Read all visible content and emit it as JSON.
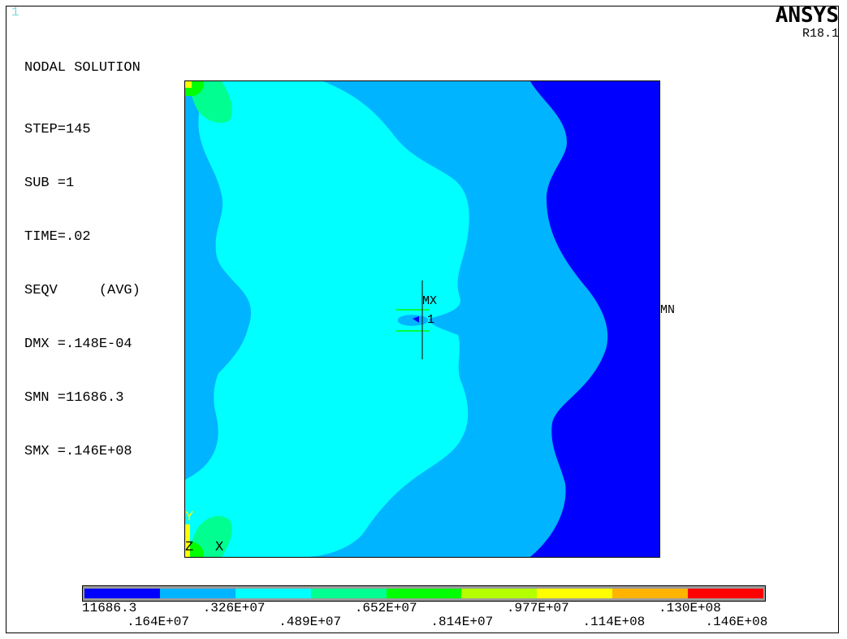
{
  "window": {
    "number": "1"
  },
  "logo": {
    "brand": "ANSYS",
    "release": "R18.1"
  },
  "info": {
    "title": "NODAL SOLUTION",
    "lines": [
      "STEP=145",
      "SUB =1",
      "TIME=.02",
      "SEQV     (AVG)",
      "DMX =.148E-04",
      "SMN =11686.3",
      "SMX =.146E+08"
    ]
  },
  "plot_labels": {
    "mx": "MX",
    "node": "1",
    "mn": "MN"
  },
  "triad": {
    "y": "Y",
    "z": "Z",
    "x": "X"
  },
  "legend": {
    "colors": [
      "#0000ff",
      "#00b4ff",
      "#00ffff",
      "#00ff90",
      "#00ff00",
      "#b4ff00",
      "#ffff00",
      "#ffb400",
      "#ff0000"
    ],
    "labels_top": [
      "11686.3",
      ".326E+07",
      ".652E+07",
      ".977E+07",
      ".130E+08"
    ],
    "labels_bottom": [
      ".164E+07",
      ".489E+07",
      ".814E+07",
      ".114E+08",
      ".146E+08"
    ]
  },
  "colors": {
    "band1": "#0000ff",
    "band2": "#00b4ff",
    "band3": "#00ffff",
    "band4": "#00ff90",
    "band5": "#00ff00",
    "band9": "#ffff00",
    "window_number": "#7fd9d9"
  }
}
